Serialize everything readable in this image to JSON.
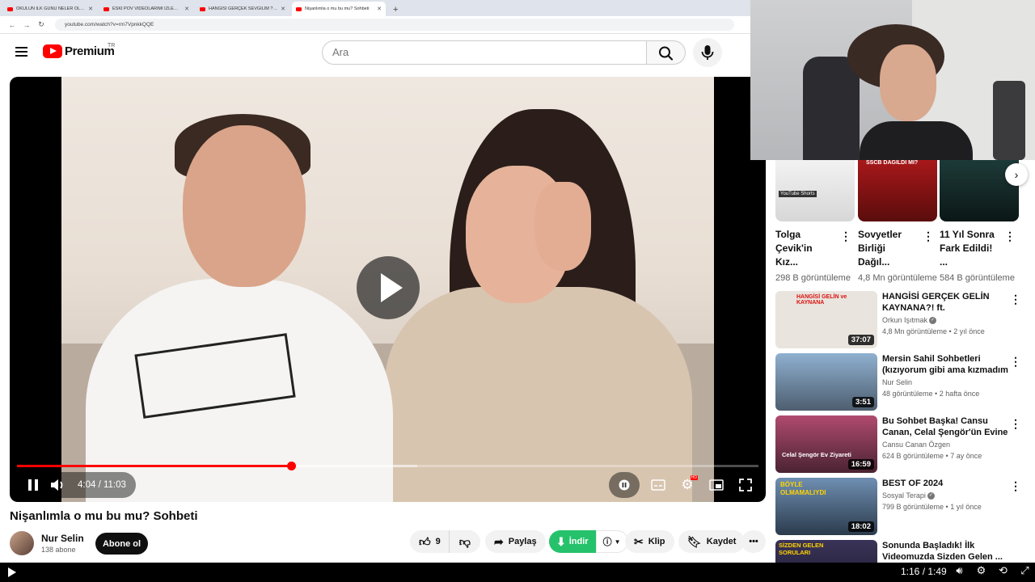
{
  "browser": {
    "tabs": [
      {
        "title": "OKULUN İLK GÜNÜ NELER OLDU...",
        "active": false
      },
      {
        "title": "ESKİ POV VİDEOLARIMI İZLEDİM...",
        "active": false
      },
      {
        "title": "HANGİSİ GERÇEK SEVGİLİM ? |...",
        "active": false
      },
      {
        "title": "Nişanlımla o mu bu mu? Sohbeti",
        "active": true
      }
    ],
    "url": "youtube.com/watch?v=rm7VpnkkQQE"
  },
  "header": {
    "logo_text": "Premium",
    "country": "TR",
    "search_placeholder": "Ara"
  },
  "player": {
    "current_time": "4:04",
    "duration": "11:03",
    "time_display": "4:04 / 11:03",
    "played_fraction": 0.37,
    "buffered_fraction": 0.54,
    "hd_badge": "HD"
  },
  "video": {
    "title": "Nişanlımla o mu bu mu? Sohbeti",
    "channel": "Nur Selin",
    "subscribers": "138 abone",
    "subscribe_label": "Abone ol",
    "likes": "9",
    "share_label": "Paylaş",
    "download_label": "İndir",
    "clip_label": "Klip",
    "save_label": "Kaydet"
  },
  "shorts": [
    {
      "title": "Tolga Çevik'in Kız...",
      "views": "298 B görüntüleme",
      "badge": "YouTube Shorts"
    },
    {
      "title": "Sovyetler Birliği Dağıl...",
      "views": "4,8 Mn görüntüleme",
      "badge": "SSCB DAĞILDI MI?"
    },
    {
      "title": "11 Yıl Sonra Fark Edildi! ...",
      "views": "584 B görüntüleme",
      "badge": ""
    }
  ],
  "related": [
    {
      "title": "HANGİSİ GERÇEK GELİN KAYNANA?! ft. @AyniSinemalar",
      "channel": "Orkun Işıtmak",
      "verified": true,
      "meta": "4,8 Mn görüntüleme • 2 yıl önce",
      "duration": "37:07",
      "thumb_text": "HANGİSİ GELİN ve KAYNANA",
      "color": "#e9e4dd"
    },
    {
      "title": "Mersin Sahil Sohbetleri (kızıyorum gibi ama kızmadım ...",
      "channel": "Nur Selin",
      "verified": false,
      "meta": "48 görüntüleme • 2 hafta önce",
      "duration": "3:51",
      "thumb_text": "",
      "color": "#6a7d94"
    },
    {
      "title": "Bu Sohbet Başka! Cansu Canan, Celal Şengör'ün Evine Konuk ...",
      "channel": "Cansu Canan Özgen",
      "verified": false,
      "meta": "624 B görüntüleme • 7 ay önce",
      "duration": "16:59",
      "thumb_text": "Celal Şengör Ev Ziyareti",
      "color": "#7a3c56"
    },
    {
      "title": "BEST OF 2024",
      "channel": "Sosyal Terapi",
      "verified": true,
      "meta": "799 B görüntüleme • 1 yıl önce",
      "duration": "18:02",
      "thumb_text": "BÖYLE OLMAMALIYDI",
      "color": "#3c5e7e"
    },
    {
      "title": "Sonunda Başladık! İlk Videomuzda Sizden Gelen ...",
      "channel": "",
      "verified": false,
      "meta": "",
      "duration": "",
      "thumb_text": "SİZDEN GELEN SORULARI",
      "color": "#2e2a48"
    }
  ],
  "bottom_bar": {
    "time": "1:16 / 1:49"
  },
  "colors": {
    "accent": "#ff0000",
    "download": "#25c26b"
  }
}
